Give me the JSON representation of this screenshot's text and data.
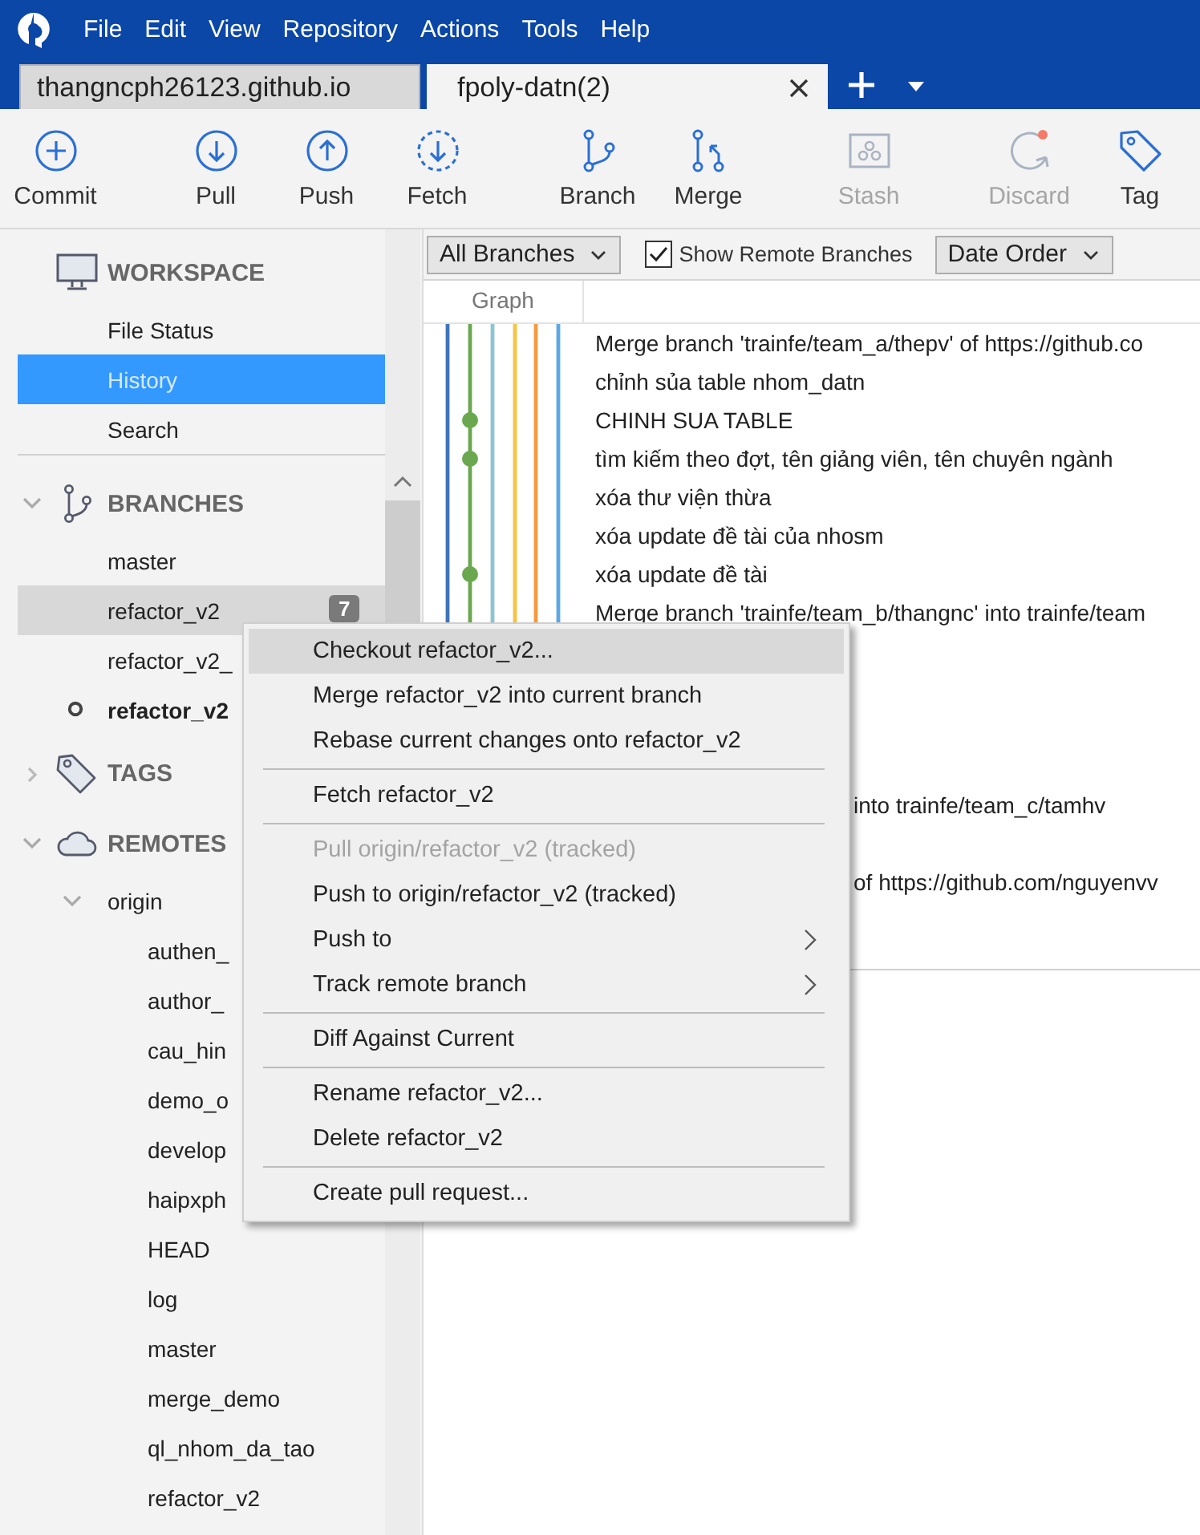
{
  "menu_bar": [
    "File",
    "Edit",
    "View",
    "Repository",
    "Actions",
    "Tools",
    "Help"
  ],
  "tabs": [
    {
      "label": "thangncph26123.github.io",
      "selected": false
    },
    {
      "label": "fpoly-datn(2)",
      "selected": true
    }
  ],
  "toolbar": [
    [
      {
        "label": "Commit",
        "kind": "commit",
        "disabled": false
      }
    ],
    [
      {
        "label": "Pull",
        "kind": "pull",
        "disabled": false
      },
      {
        "label": "Push",
        "kind": "push",
        "disabled": false
      },
      {
        "label": "Fetch",
        "kind": "fetch",
        "disabled": false
      }
    ],
    [
      {
        "label": "Branch",
        "kind": "branch",
        "disabled": false
      },
      {
        "label": "Merge",
        "kind": "merge",
        "disabled": false
      }
    ],
    [
      {
        "label": "Stash",
        "kind": "stash",
        "disabled": true
      }
    ],
    [
      {
        "label": "Discard",
        "kind": "discard",
        "disabled": true
      },
      {
        "label": "Tag",
        "kind": "tag",
        "disabled": false
      }
    ]
  ],
  "sidebar": {
    "workspace": {
      "title": "WORKSPACE",
      "items": [
        {
          "label": "File Status",
          "selected": false
        },
        {
          "label": "History",
          "selected": true
        },
        {
          "label": "Search",
          "selected": false
        }
      ]
    },
    "branches": {
      "title": "BRANCHES",
      "expanded": true,
      "items": [
        {
          "label": "master",
          "highlighted": false,
          "current": false
        },
        {
          "label": "refactor_v2",
          "highlighted": true,
          "current": false,
          "badge": "7"
        },
        {
          "label": "refactor_v2_",
          "highlighted": false,
          "current": false
        },
        {
          "label": "refactor_v2",
          "highlighted": false,
          "current": true
        }
      ]
    },
    "tags": {
      "title": "TAGS",
      "expanded": false
    },
    "remotes": {
      "title": "REMOTES",
      "expanded": true,
      "children": [
        {
          "label": "origin",
          "expanded": true,
          "children": [
            "authen_",
            "author_",
            "cau_hin",
            "demo_o",
            "develop",
            "haipxph",
            "HEAD",
            "log",
            "master",
            "merge_demo",
            "ql_nhom_da_tao",
            "refactor_v2"
          ]
        }
      ]
    }
  },
  "filter_bar": {
    "branch_filter": "All Branches",
    "show_remote": {
      "label": "Show Remote Branches",
      "checked": true
    },
    "order": "Date Order"
  },
  "history": {
    "columns": [
      "Graph"
    ],
    "commits": [
      {
        "message": "Merge branch 'trainfe/team_a/thepv' of https://github.co",
        "kind": "full"
      },
      {
        "message": "chỉnh sủa table nhom_datn",
        "kind": "full"
      },
      {
        "message": "CHINH SUA TABLE",
        "kind": "full"
      },
      {
        "message": "tìm kiếm theo đợt, tên giảng viên, tên chuyên ngành",
        "kind": "full"
      },
      {
        "message": "xóa thư viện thừa",
        "kind": "full"
      },
      {
        "message": "xóa update đề tài của nhosm",
        "kind": "full"
      },
      {
        "message": "xóa update đề tài",
        "kind": "full"
      },
      {
        "message": "Merge branch 'trainfe/team_b/thangnc' into trainfe/team",
        "kind": "full"
      },
      {
        "message": "into trainfe/team_c/tamhv",
        "kind": "partial"
      },
      {
        "message": "of https://github.com/nguyenvv",
        "kind": "partial"
      }
    ]
  },
  "context_menu": [
    {
      "kind": "item",
      "label": "Checkout refactor_v2...",
      "selected": true,
      "disabled": false,
      "submenu": false
    },
    {
      "kind": "item",
      "label": "Merge refactor_v2 into current branch",
      "selected": false,
      "disabled": false,
      "submenu": false
    },
    {
      "kind": "item",
      "label": "Rebase current changes onto refactor_v2",
      "selected": false,
      "disabled": false,
      "submenu": false
    },
    {
      "kind": "separator"
    },
    {
      "kind": "item",
      "label": "Fetch refactor_v2",
      "selected": false,
      "disabled": false,
      "submenu": false
    },
    {
      "kind": "separator"
    },
    {
      "kind": "item",
      "label": "Pull origin/refactor_v2 (tracked)",
      "selected": false,
      "disabled": true,
      "submenu": false
    },
    {
      "kind": "item",
      "label": "Push to origin/refactor_v2 (tracked)",
      "selected": false,
      "disabled": false,
      "submenu": false
    },
    {
      "kind": "item",
      "label": "Push to",
      "selected": false,
      "disabled": false,
      "submenu": true
    },
    {
      "kind": "item",
      "label": "Track remote branch",
      "selected": false,
      "disabled": false,
      "submenu": true
    },
    {
      "kind": "separator"
    },
    {
      "kind": "item",
      "label": "Diff Against Current",
      "selected": false,
      "disabled": false,
      "submenu": false
    },
    {
      "kind": "separator"
    },
    {
      "kind": "item",
      "label": "Rename refactor_v2...",
      "selected": false,
      "disabled": false,
      "submenu": false
    },
    {
      "kind": "item",
      "label": "Delete refactor_v2",
      "selected": false,
      "disabled": false,
      "submenu": false
    },
    {
      "kind": "separator"
    },
    {
      "kind": "item",
      "label": "Create pull request...",
      "selected": false,
      "disabled": false,
      "submenu": false
    }
  ]
}
